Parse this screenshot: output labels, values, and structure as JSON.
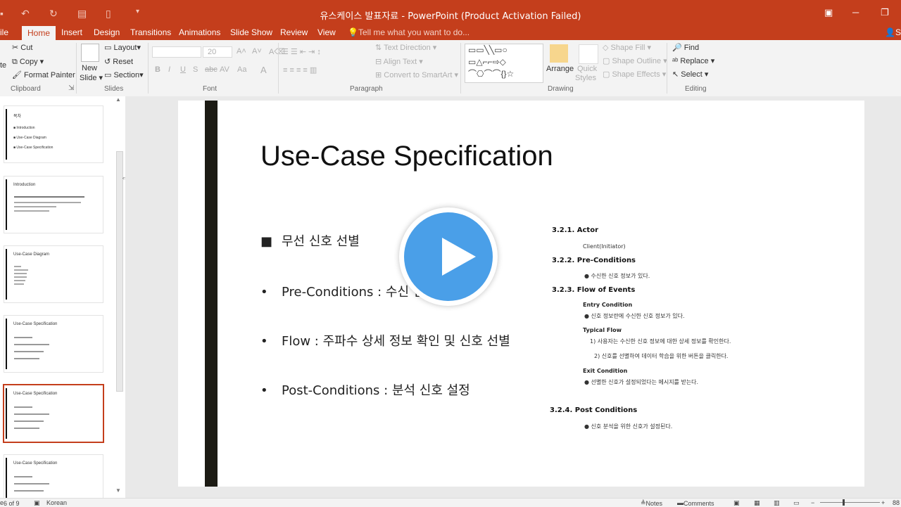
{
  "window": {
    "title": "유스케이스 발표자료 - PowerPoint (Product Activation Failed)",
    "user_initial": "S"
  },
  "tabs": [
    "File",
    "Home",
    "Insert",
    "Design",
    "Transitions",
    "Animations",
    "Slide Show",
    "Review",
    "View"
  ],
  "tabs_active": "Home",
  "file_tab_visible": "ile",
  "tell_me": "Tell me what you want to do...",
  "ribbon": {
    "clipboard": {
      "cut": "Cut",
      "copy": "Copy",
      "format_painter": "Format Painter",
      "paste_partial": "te",
      "label": "Clipboard"
    },
    "slides": {
      "new_slide": "New",
      "new_slide2": "Slide",
      "layout": "Layout",
      "reset": "Reset",
      "section": "Section",
      "label": "Slides"
    },
    "font": {
      "size": "20",
      "label": "Font"
    },
    "paragraph": {
      "text_direction": "Text Direction",
      "align_text": "Align Text",
      "convert_smartart": "Convert to SmartArt",
      "label": "Paragraph"
    },
    "drawing": {
      "arrange": "Arrange",
      "quick_styles": "Quick",
      "quick_styles2": "Styles",
      "shape_fill": "Shape Fill",
      "shape_outline": "Shape Outline",
      "shape_effects": "Shape Effects",
      "label": "Drawing"
    },
    "editing": {
      "find": "Find",
      "replace": "Replace",
      "select": "Select",
      "label": "Editing"
    }
  },
  "thumbnails": [
    {
      "title": "목차",
      "lines": [
        "Introduction",
        "Use-Case Diagram",
        "Use-Case Specification"
      ]
    },
    {
      "title": "Introduction"
    },
    {
      "title": "Use-Case Diagram"
    },
    {
      "title": "Use-Case Specification"
    },
    {
      "title": "Use-Case Specification"
    },
    {
      "title": "Use-Case Specification"
    }
  ],
  "slide": {
    "title": "Use-Case Specification",
    "bullets": [
      {
        "marker": "■",
        "text": "무선 신호 선별"
      },
      {
        "marker": "•",
        "text": "Pre-Conditions : 수신 신호 정보"
      },
      {
        "marker": "•",
        "text": "Flow : 주파수 상세 정보 확인 및 신호 선별"
      },
      {
        "marker": "•",
        "text": "Post-Conditions : 분석 신호 설정"
      }
    ],
    "spec": {
      "actor_h": "3.2.1. Actor",
      "actor_v": "Client(Initiator)",
      "pre_h": "3.2.2. Pre-Conditions",
      "pre_v": "수신한 신호 정보가 있다.",
      "flow_h": "3.2.3. Flow of Events",
      "entry_h": "Entry Condition",
      "entry_v": "신호 정보란에 수신한 신호 정보가 있다.",
      "typical_h": "Typical Flow",
      "typical_1": "1)    사용자는 수신한 신호 정보에 대한 상세 정보를 확인한다.",
      "typical_2": "2) 신호를 선별하여 데이터 학습을 위한 버튼을 클릭한다.",
      "exit_h": "Exit Condition",
      "exit_v": "선별한 신호가 설정되었다는 메시지를 받는다.",
      "post_h": "3.2.4.  Post Conditions",
      "post_v": "신호 분석을 위한 신호가 설정된다."
    }
  },
  "status": {
    "slide_count": "6 of 9",
    "language": "Korean",
    "notes": "Notes",
    "comments": "Comments",
    "zoom": "88"
  },
  "colors": {
    "accent": "#c43e1c",
    "play": "#4a9fe8",
    "slide_bar": "#1c1b14"
  }
}
